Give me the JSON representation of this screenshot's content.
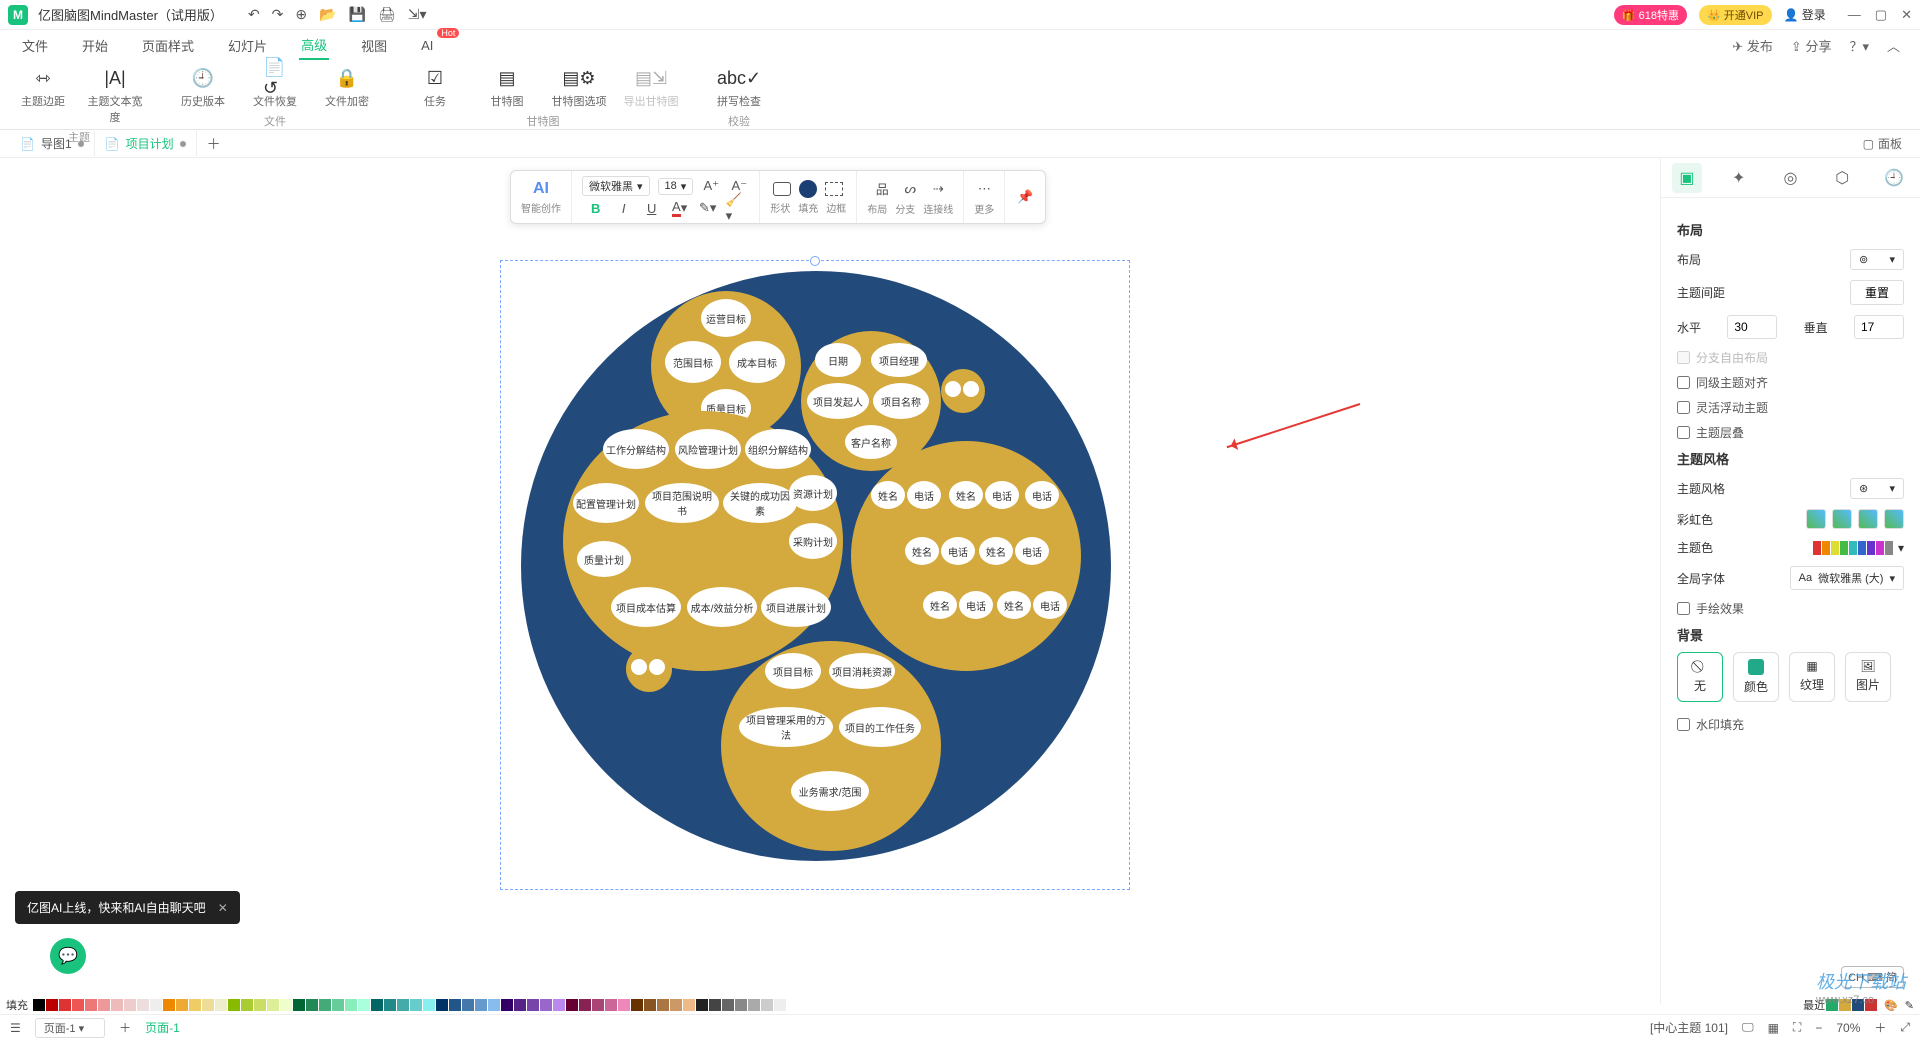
{
  "titlebar": {
    "app_name": "亿图脑图MindMaster",
    "edition": "（试用版）",
    "promo_618": "🎁 618特惠",
    "open_vip": "👑 开通VIP",
    "login": "登录"
  },
  "menu": {
    "file": "文件",
    "start": "开始",
    "page_style": "页面样式",
    "slideshow": "幻灯片",
    "advanced": "高级",
    "view": "视图",
    "ai": "AI",
    "hot": "Hot",
    "publish": "发布",
    "share": "分享"
  },
  "ribbon": {
    "theme_spacing": "主题边距",
    "theme_text_width": "主题文本宽度",
    "group_theme": "主题",
    "history": "历史版本",
    "file_restore": "文件恢复",
    "file_encrypt": "文件加密",
    "group_file": "文件",
    "task": "任务",
    "gantt": "甘特图",
    "gantt_options": "甘特图选项",
    "export_gantt": "导出甘特图",
    "group_gantt": "甘特图",
    "spell_check": "拼写检查",
    "group_check": "校验"
  },
  "tabs": {
    "tab1": "导图1",
    "tab2": "项目计划",
    "panel_label": "面板"
  },
  "floatbar": {
    "ai": "AI",
    "ai_sub": "智能创作",
    "font": "微软雅黑",
    "size": "18",
    "shape": "形状",
    "fill": "填充",
    "border": "边框",
    "layout": "布局",
    "branch": "分支",
    "connector": "连接线",
    "more": "更多"
  },
  "mindmap": {
    "c1": {
      "a": "运营目标",
      "b": "范围目标",
      "c": "成本目标",
      "d": "质量目标"
    },
    "c2": {
      "a": "日期",
      "b": "项目经理",
      "c": "项目发起人",
      "d": "项目名称",
      "e": "客户名称"
    },
    "c3": {
      "a": "工作分解结构",
      "b": "风险管理计划",
      "c": "组织分解结构",
      "d": "配置管理计划",
      "e": "项目范围说明书",
      "f": "关键的成功因素",
      "g": "资源计划",
      "h": "质量计划",
      "i": "采购计划",
      "j": "项目成本估算",
      "k": "成本/效益分析",
      "l": "项目进展计划"
    },
    "c4": {
      "name": "姓名",
      "phone": "电话"
    },
    "c5": {
      "a": "项目目标",
      "b": "项目消耗资源",
      "c": "项目管理采用的方法",
      "d": "项目的工作任务",
      "e": "业务需求/范围"
    }
  },
  "right_panel": {
    "section_layout": "布局",
    "layout_label": "布局",
    "spacing_label": "主题间距",
    "reset": "重置",
    "horizontal": "水平",
    "h_val": "30",
    "vertical": "垂直",
    "v_val": "17",
    "free_layout": "分支自由布局",
    "same_level_align": "同级主题对齐",
    "float_topic": "灵活浮动主题",
    "topic_stack": "主题层叠",
    "section_style": "主题风格",
    "style_label": "主题风格",
    "rainbow": "彩虹色",
    "theme_color": "主题色",
    "global_font": "全局字体",
    "font_value": "微软雅黑 (大)",
    "hand_drawn": "手绘效果",
    "section_bg": "背景",
    "bg_none": "无",
    "bg_color": "颜色",
    "bg_texture": "纹理",
    "bg_image": "图片",
    "watermark_fill": "水印填充"
  },
  "toast": {
    "text": "亿图AI上线，快来和AI自由聊天吧"
  },
  "colorbar": {
    "fill_label": "填充",
    "recent_label": "最近"
  },
  "statusbar": {
    "page_sel": "页面-1",
    "page_tab": "页面-1",
    "center": "[中心主题 101]",
    "zoom": "70%",
    "ime": "CH ⌨ 简"
  },
  "watermark": {
    "brand": "极光下载站",
    "url": "www.xz7.co"
  }
}
